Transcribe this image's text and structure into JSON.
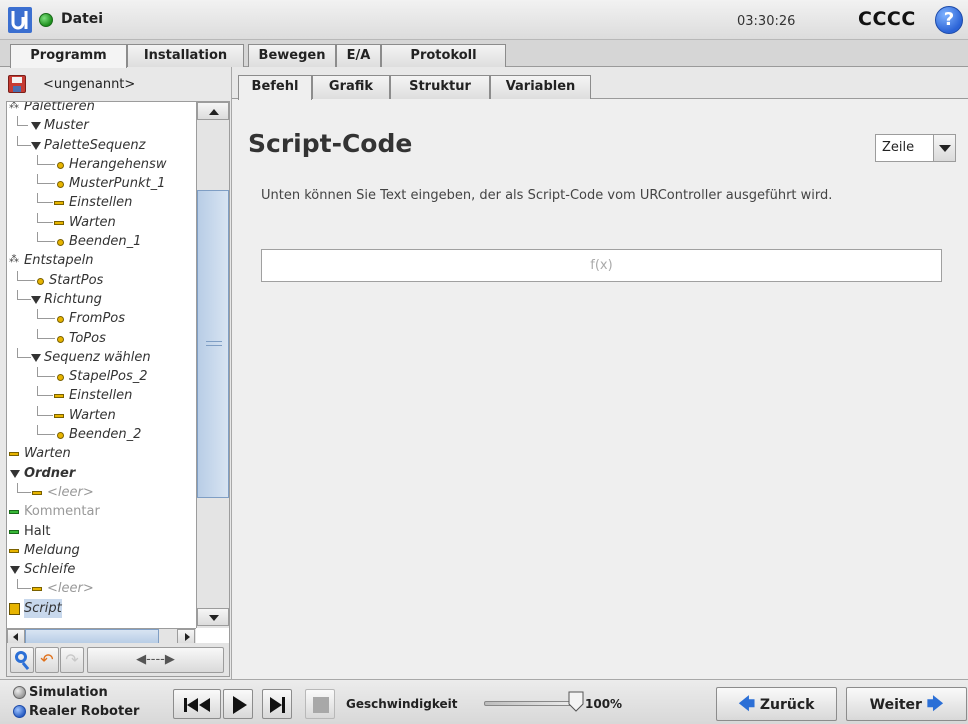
{
  "titlebar": {
    "title": "Datei",
    "clock": "03:30:26",
    "robot_name": "CCCC",
    "help_symbol": "?"
  },
  "main_tabs": [
    "Programm",
    "Installation",
    "Bewegen",
    "E/A",
    "Protokoll"
  ],
  "program": {
    "name": "<ungenannt>"
  },
  "tree": [
    {
      "label": "Palettieren",
      "icon": "palette-icon"
    },
    {
      "label": "Muster",
      "icon": "triangle-icon"
    },
    {
      "label": "PaletteSequenz",
      "icon": "triangle-icon"
    },
    {
      "label": "Herangehensw",
      "icon": "waypoint-icon"
    },
    {
      "label": "MusterPunkt_1",
      "icon": "waypoint-icon"
    },
    {
      "label": "Einstellen",
      "icon": "command-bar-icon"
    },
    {
      "label": "Warten",
      "icon": "command-bar-icon"
    },
    {
      "label": "Beenden_1",
      "icon": "waypoint-icon"
    },
    {
      "label": "Entstapeln",
      "icon": "palette-icon"
    },
    {
      "label": "StartPos",
      "icon": "waypoint-icon"
    },
    {
      "label": "Richtung",
      "icon": "triangle-icon"
    },
    {
      "label": "FromPos",
      "icon": "waypoint-icon"
    },
    {
      "label": "ToPos",
      "icon": "waypoint-icon"
    },
    {
      "label": "Sequenz wählen",
      "icon": "triangle-icon"
    },
    {
      "label": "StapelPos_2",
      "icon": "waypoint-icon"
    },
    {
      "label": "Einstellen",
      "icon": "command-bar-icon"
    },
    {
      "label": "Warten",
      "icon": "command-bar-icon"
    },
    {
      "label": "Beenden_2",
      "icon": "waypoint-icon"
    },
    {
      "label": "Warten",
      "icon": "command-bar-icon"
    },
    {
      "label": "Ordner",
      "icon": "triangle-icon"
    },
    {
      "label": "<leer>",
      "icon": "command-bar-icon"
    },
    {
      "label": "Kommentar",
      "icon": "comment-icon"
    },
    {
      "label": "Halt",
      "icon": "halt-icon"
    },
    {
      "label": "Meldung",
      "icon": "command-bar-icon"
    },
    {
      "label": "Schleife",
      "icon": "triangle-icon"
    },
    {
      "label": "<leer>",
      "icon": "command-bar-icon"
    },
    {
      "label": "Script",
      "icon": "script-icon"
    }
  ],
  "tree_tools": {
    "move_symbol": "◀----▶"
  },
  "sub_tabs": [
    "Befehl",
    "Grafik",
    "Struktur",
    "Variablen"
  ],
  "content": {
    "title": "Script-Code",
    "mode_select": "Zeile",
    "description": "Unten können Sie Text eingeben, der als Script-Code vom URController ausgeführt wird.",
    "expression_placeholder": "f(x)"
  },
  "bottom": {
    "mode_simulation": "Simulation",
    "mode_real": "Realer Roboter",
    "speed_label": "Geschwindigkeit",
    "speed_value": "100%",
    "speed_fraction": 1.0,
    "back_label": "Zurück",
    "next_label": "Weiter"
  },
  "colors": {
    "accent_blue": "#2b6fd6",
    "waypoint_yellow": "#e7b400",
    "halt_green": "#38b838"
  }
}
